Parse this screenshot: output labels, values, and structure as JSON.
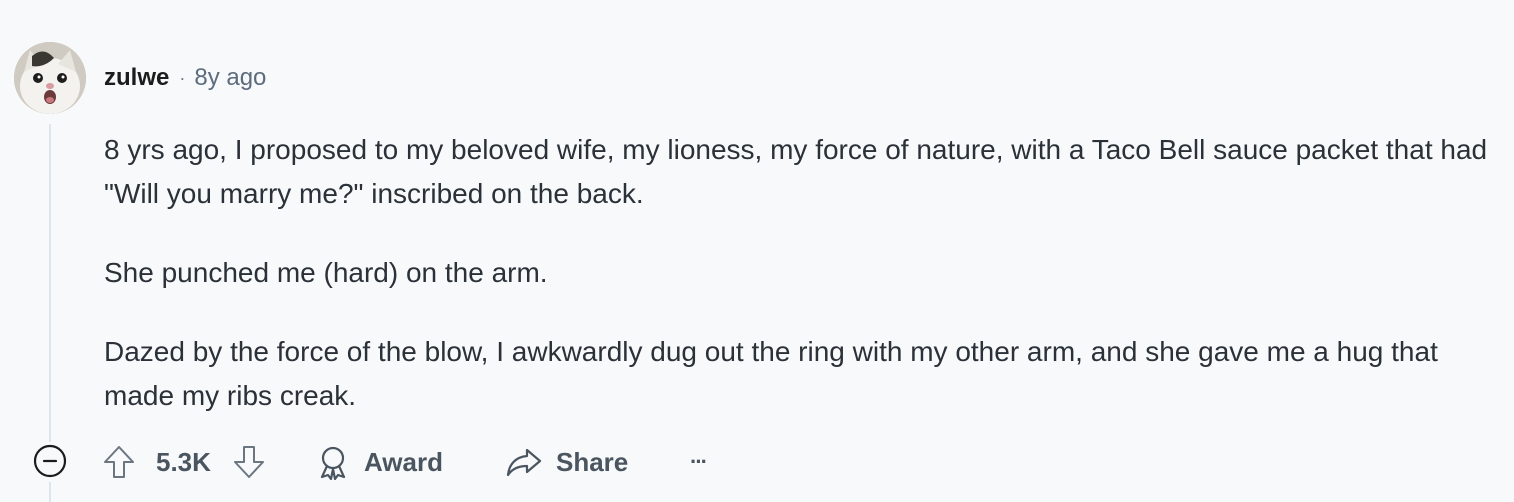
{
  "comment": {
    "username": "zulwe",
    "separator": "·",
    "age": "8y ago",
    "paragraphs": [
      "8 yrs ago, I proposed to my beloved wife, my lioness, my force of nature, with a Taco Bell sauce packet that had \"Will you marry me?\" inscribed on the back.",
      "She punched me (hard) on the arm.",
      "Dazed by the force of the blow, I awkwardly dug out the ring with my other arm, and she gave me a hug that made my ribs creak."
    ]
  },
  "actions": {
    "score": "5.3K",
    "award_label": "Award",
    "share_label": "Share",
    "more_label": "···"
  },
  "icons": {
    "collapse": "minus-circle-icon",
    "upvote": "arrow-up-icon",
    "downvote": "arrow-down-icon",
    "award": "award-ribbon-icon",
    "share": "share-arrow-icon"
  },
  "colors": {
    "background": "#f8f9fb",
    "thread_line": "#dfe5ec",
    "meta_text": "#5c6c7c",
    "action_text": "#4a5560"
  }
}
